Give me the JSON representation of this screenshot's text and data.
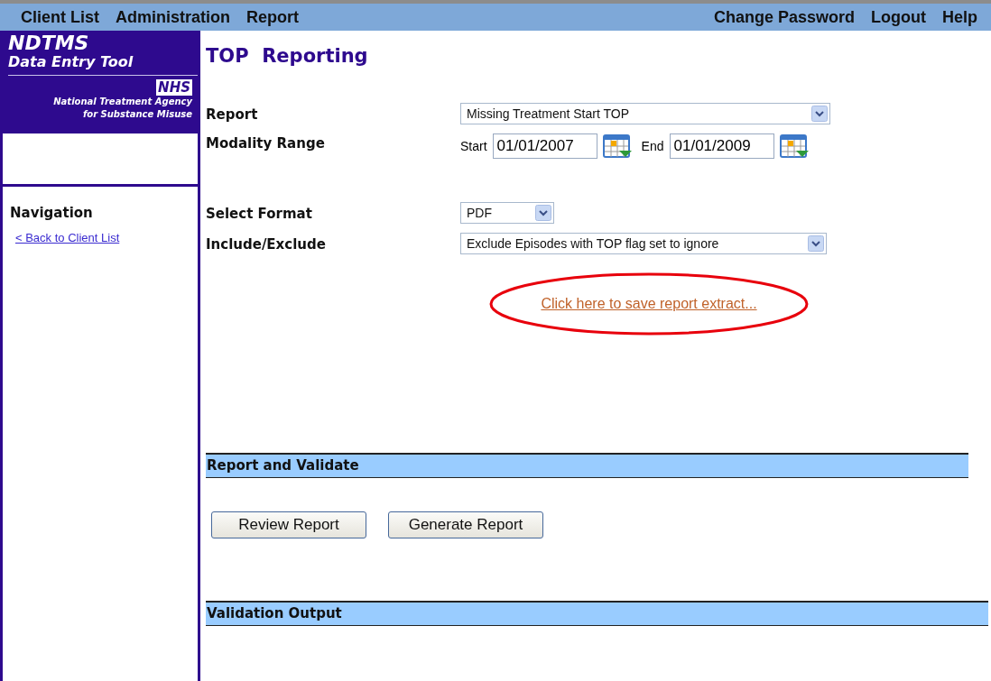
{
  "menu_left": [
    "Client List",
    "Administration",
    "Report"
  ],
  "menu_right": [
    "Change Password",
    "Logout",
    "Help"
  ],
  "logo": {
    "title": "NDTMS",
    "subtitle": "Data Entry Tool",
    "badge": "NHS",
    "agency": [
      "National Treatment Agency",
      "for Substance Misuse"
    ]
  },
  "navigation": {
    "heading": "Navigation",
    "links": [
      "< Back to Client List"
    ]
  },
  "page_title": "TOP  Reporting",
  "form": {
    "report": {
      "label": "Report",
      "value": "Missing Treatment Start TOP"
    },
    "modality_range": {
      "label": "Modality Range",
      "start_label": "Start",
      "start": "01/01/2007",
      "end_label": "End",
      "end": "01/01/2009"
    },
    "format": {
      "label": "Select Format",
      "value": "PDF"
    },
    "include_exclude": {
      "label": "Include/Exclude",
      "value": "Exclude Episodes with TOP flag set to ignore"
    },
    "save_link": "Click here to save report extract..."
  },
  "report_section": {
    "title": "Report and Validate",
    "buttons": [
      "Review Report",
      "Generate Report"
    ]
  },
  "output_section": {
    "title": "Validation Output"
  }
}
